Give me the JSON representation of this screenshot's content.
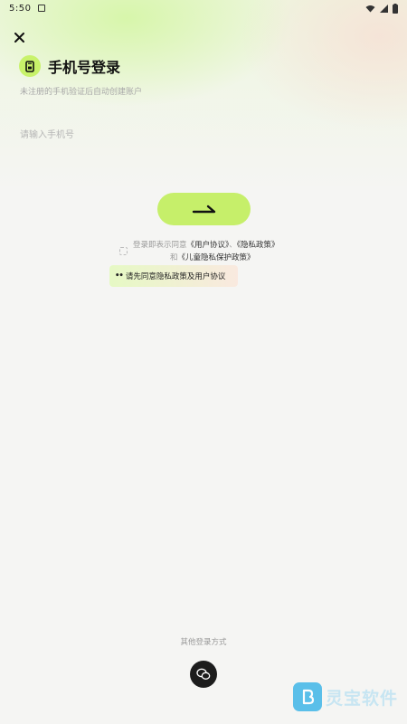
{
  "status_bar": {
    "time": "5:50"
  },
  "header": {
    "title": "手机号登录",
    "subtitle": "未注册的手机验证后自动创建账户"
  },
  "form": {
    "phone_placeholder": "请输入手机号",
    "phone_value": ""
  },
  "agreement": {
    "prefix": "登录即表示同意",
    "user_agreement": "《用户协议》",
    "separator": "、",
    "privacy_policy": "《隐私政策》",
    "and": "和",
    "child_policy": "《儿童隐私保护政策》"
  },
  "toast": {
    "message": "请先同意隐私政策及用户协议"
  },
  "footer": {
    "other_methods": "其他登录方式"
  },
  "watermark": {
    "text": "灵宝软件"
  },
  "colors": {
    "accent": "#c6ef6a",
    "background": "#f5f5f3",
    "toast_start": "#e6f9c4",
    "toast_end": "#f9e9df",
    "dark": "#1c1c1c"
  },
  "icons": {
    "close": "close-icon",
    "title_badge": "phone-icon",
    "login_arrow": "arrow-right-icon",
    "wechat": "wechat-icon"
  }
}
